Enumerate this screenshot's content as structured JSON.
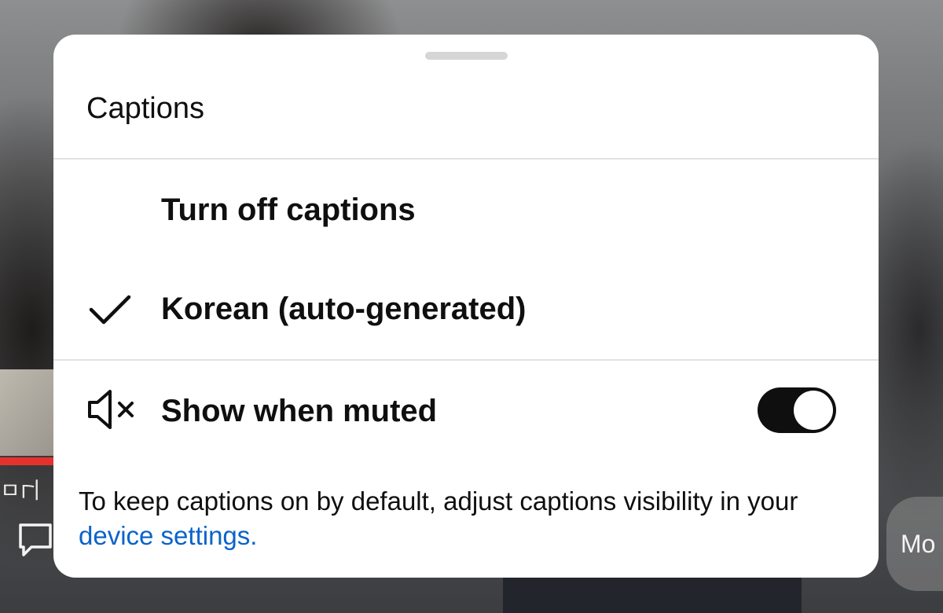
{
  "sheet": {
    "title": "Captions",
    "options": [
      {
        "label": "Turn off captions",
        "selected": false
      },
      {
        "label": "Korean (auto-generated)",
        "selected": true
      }
    ],
    "show_when_muted": {
      "label": "Show when muted",
      "icon": "speaker-muted-icon",
      "enabled": true
    },
    "footnote": {
      "text_before": "To keep captions on by default, adjust captions visibility in your ",
      "link": "device settings",
      "text_after": "."
    }
  },
  "background": {
    "fragment_text": "ㅁ니",
    "more_button_label": "Mo",
    "progress_color": "#e5322d"
  },
  "colors": {
    "link": "#0b63c9",
    "toggle_on": "#0f0f0f"
  }
}
